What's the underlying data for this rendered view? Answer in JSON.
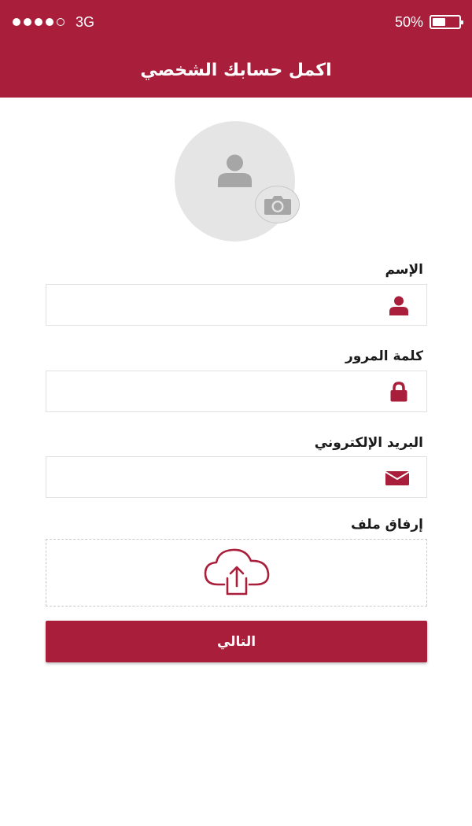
{
  "status_bar": {
    "carrier": "3G",
    "signal_bars_filled": 4,
    "signal_bars_total": 5,
    "battery_percent": "50%",
    "battery_level": 0.5
  },
  "header": {
    "title": "اكمل حسابك الشخصي"
  },
  "avatar": {
    "placeholder_icon": "user-icon",
    "action_icon": "camera-icon"
  },
  "form": {
    "name": {
      "label": "الإسم",
      "value": "",
      "icon": "user-icon"
    },
    "password": {
      "label": "كلمة المرور",
      "value": "",
      "icon": "lock-icon"
    },
    "email": {
      "label": "البريد الإلكتروني",
      "value": "",
      "icon": "envelope-icon"
    },
    "attachment": {
      "label": "إرفاق ملف",
      "icon": "cloud-upload-icon"
    }
  },
  "actions": {
    "next_label": "التالي"
  },
  "colors": {
    "primary": "#a91e3a",
    "avatar_bg": "#e5e5e5",
    "icon_gray": "#a6a6a6"
  }
}
